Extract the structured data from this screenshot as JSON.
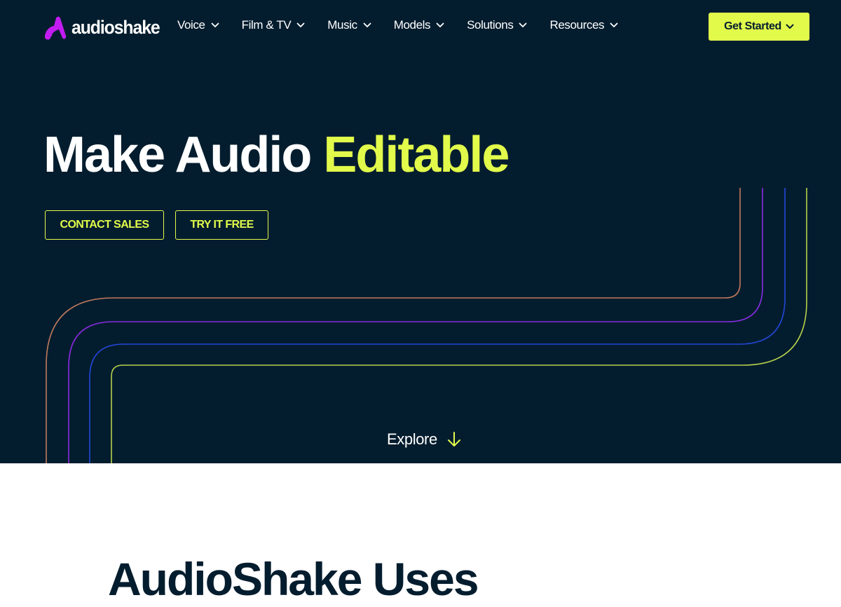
{
  "brand": {
    "name": "audioshake",
    "logo_icon": "audioshake-logo-icon",
    "logo_color": "#c21cf2"
  },
  "nav": {
    "items": [
      {
        "label": "Voice"
      },
      {
        "label": "Film & TV"
      },
      {
        "label": "Music"
      },
      {
        "label": "Models"
      },
      {
        "label": "Solutions"
      },
      {
        "label": "Resources"
      }
    ],
    "cta": "Get Started"
  },
  "hero": {
    "headline_start": "Make Audio ",
    "headline_accent": "Editable",
    "buttons": {
      "contact": "CONTACT SALES",
      "try": "TRY IT FREE"
    },
    "explore": "Explore",
    "line_colors": [
      "#c27a5d",
      "#8a2be2",
      "#2346d8",
      "#b6d04a"
    ]
  },
  "section": {
    "title": "AudioShake Uses"
  },
  "colors": {
    "background": "#041d2e",
    "accent": "#e2fb4b",
    "text": "#ffffff"
  }
}
